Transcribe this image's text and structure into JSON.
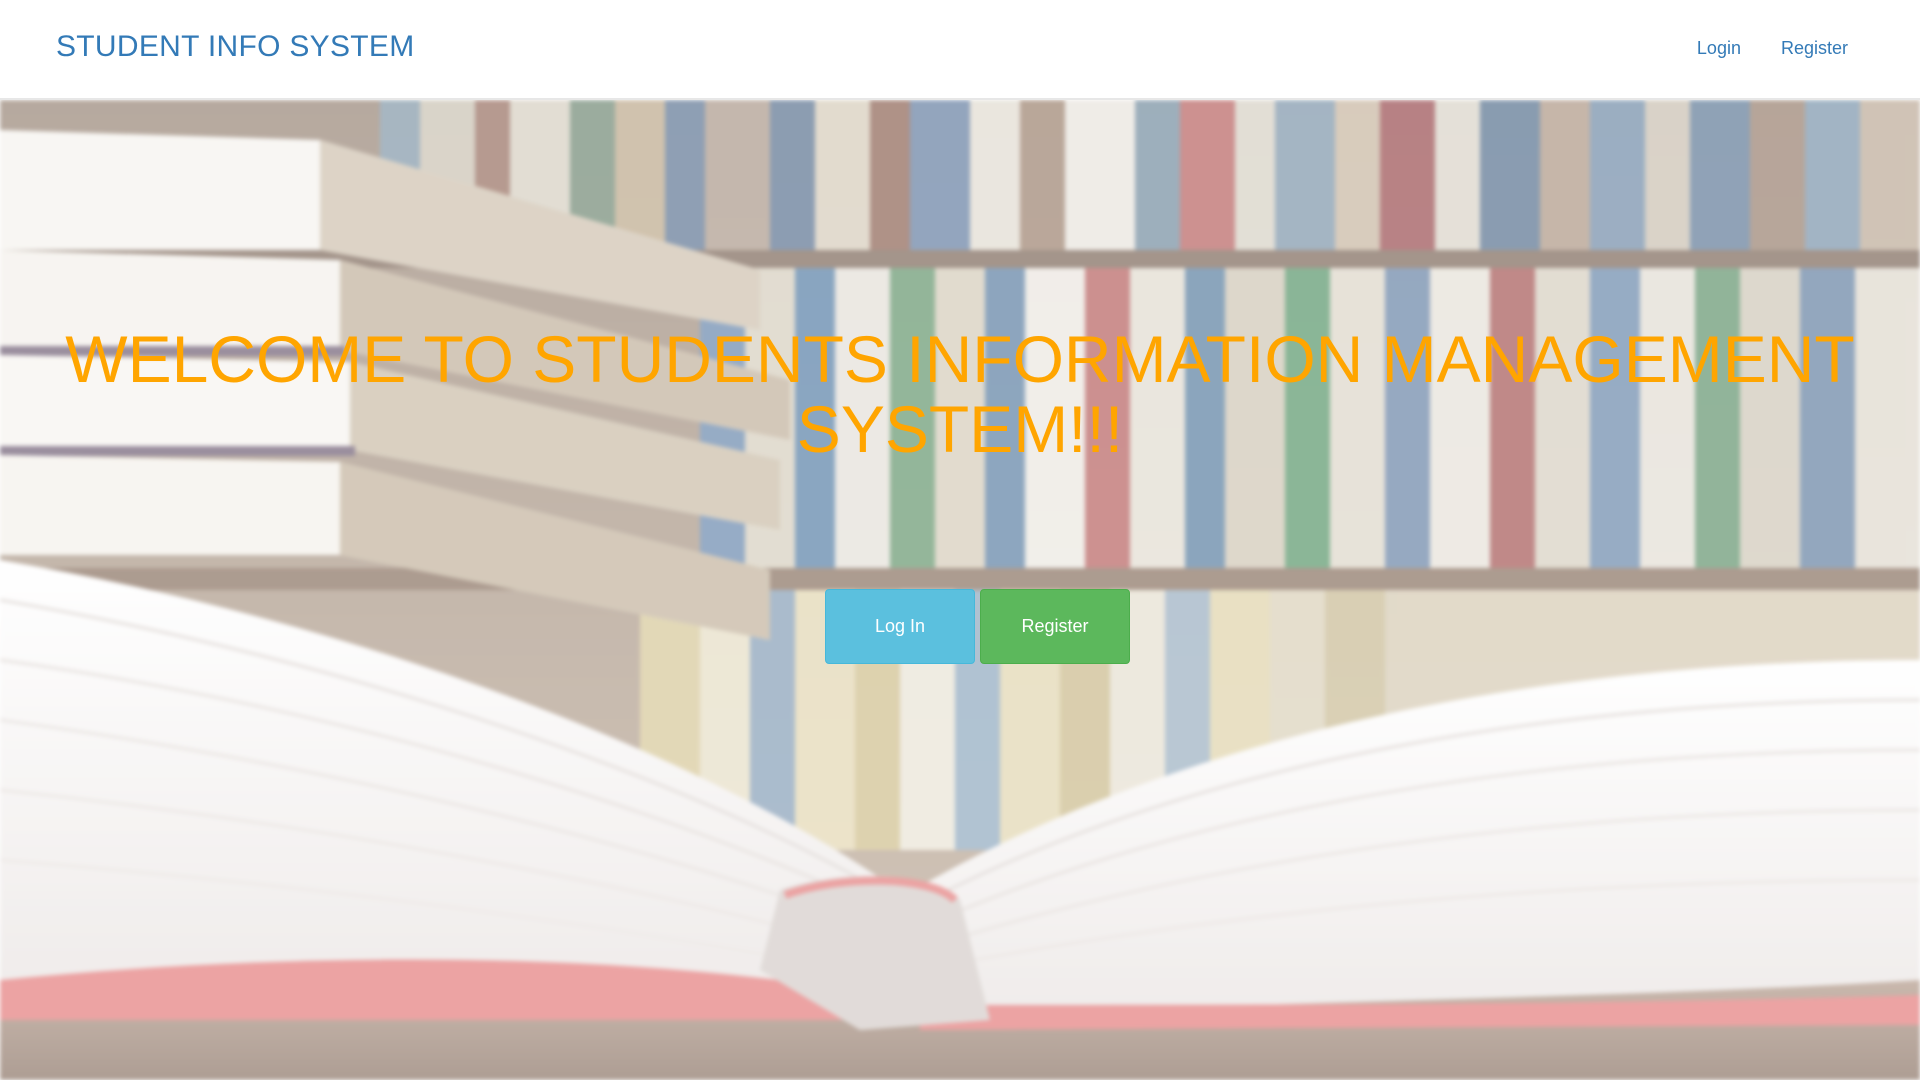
{
  "navbar": {
    "brand": "STUDENT INFO SYSTEM",
    "links": [
      "Login",
      "Register"
    ]
  },
  "hero": {
    "welcome_line1": "WELCOME TO STUDENTS INFORMATION MANAGEMENT",
    "welcome_line2": "SYSTEM!!!",
    "login_button": "Log In",
    "register_button": "Register"
  },
  "colors": {
    "brand": "#337ab7",
    "welcome": "#ffa500",
    "login_button": "#5bc0de",
    "register_button": "#5cb85c"
  }
}
